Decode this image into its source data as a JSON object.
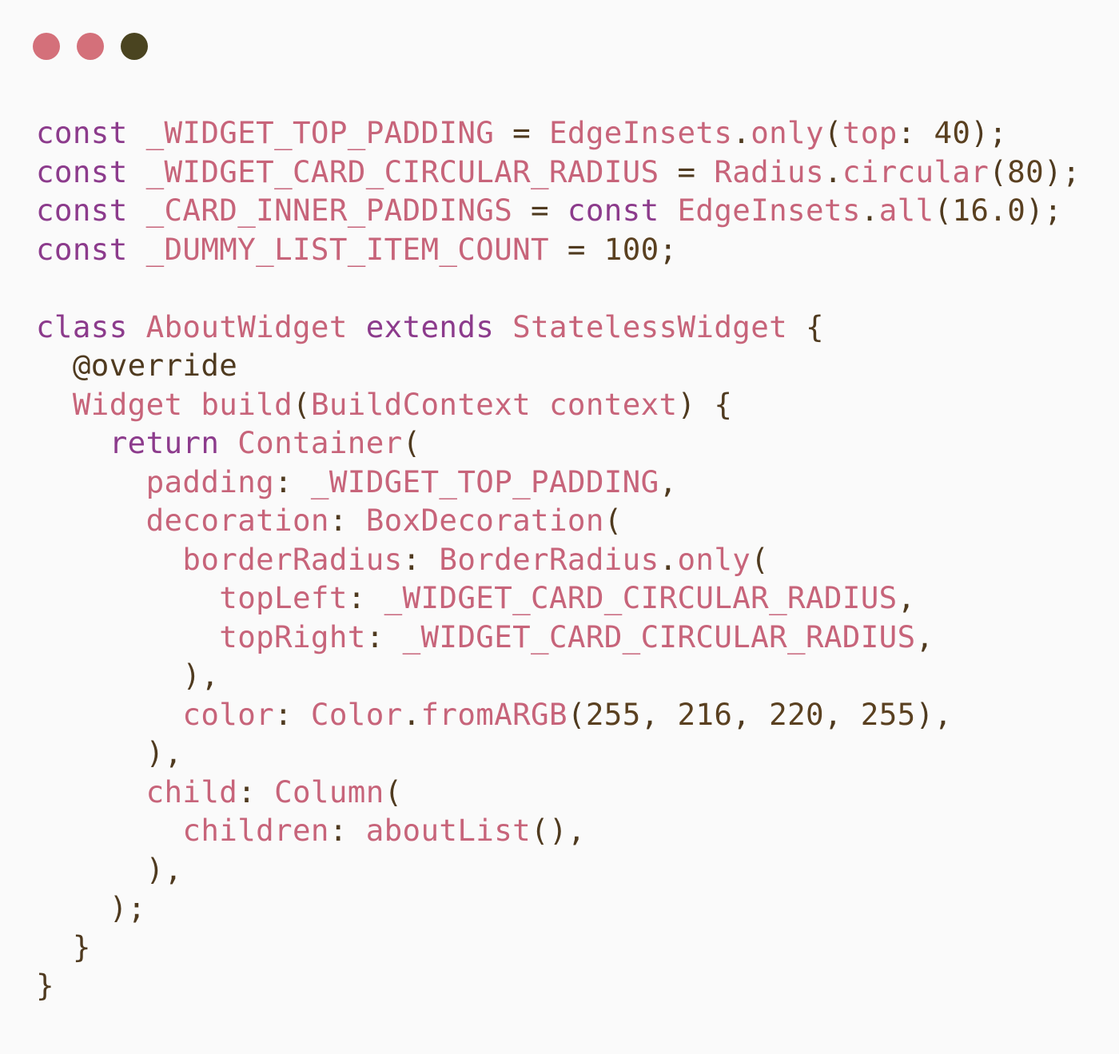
{
  "window": {
    "controls": [
      {
        "name": "close",
        "color": "#d4707a"
      },
      {
        "name": "minimize",
        "color": "#d4707a"
      },
      {
        "name": "maximize",
        "color": "#4a4420"
      }
    ]
  },
  "colors": {
    "keyword": "#8c3b8c",
    "identifier": "#c7647a",
    "plain": "#4f3a1f",
    "number": "#5a4020",
    "background": "#fafafa"
  },
  "code_lines": [
    [
      [
        "keyword",
        "const"
      ],
      [
        "plain",
        " "
      ],
      [
        "ident",
        "_WIDGET_TOP_PADDING"
      ],
      [
        "plain",
        " = "
      ],
      [
        "ident",
        "EdgeInsets"
      ],
      [
        "plain",
        "."
      ],
      [
        "ident",
        "only"
      ],
      [
        "plain",
        "("
      ],
      [
        "ident",
        "top"
      ],
      [
        "plain",
        ": "
      ],
      [
        "number",
        "40"
      ],
      [
        "plain",
        ");"
      ]
    ],
    [
      [
        "keyword",
        "const"
      ],
      [
        "plain",
        " "
      ],
      [
        "ident",
        "_WIDGET_CARD_CIRCULAR_RADIUS"
      ],
      [
        "plain",
        " = "
      ],
      [
        "ident",
        "Radius"
      ],
      [
        "plain",
        "."
      ],
      [
        "ident",
        "circular"
      ],
      [
        "plain",
        "("
      ],
      [
        "number",
        "80"
      ],
      [
        "plain",
        ");"
      ]
    ],
    [
      [
        "keyword",
        "const"
      ],
      [
        "plain",
        " "
      ],
      [
        "ident",
        "_CARD_INNER_PADDINGS"
      ],
      [
        "plain",
        " = "
      ],
      [
        "keyword",
        "const"
      ],
      [
        "plain",
        " "
      ],
      [
        "ident",
        "EdgeInsets"
      ],
      [
        "plain",
        "."
      ],
      [
        "ident",
        "all"
      ],
      [
        "plain",
        "("
      ],
      [
        "number",
        "16.0"
      ],
      [
        "plain",
        ");"
      ]
    ],
    [
      [
        "keyword",
        "const"
      ],
      [
        "plain",
        " "
      ],
      [
        "ident",
        "_DUMMY_LIST_ITEM_COUNT"
      ],
      [
        "plain",
        " = "
      ],
      [
        "number",
        "100"
      ],
      [
        "plain",
        ";"
      ]
    ],
    [],
    [
      [
        "keyword",
        "class"
      ],
      [
        "plain",
        " "
      ],
      [
        "ident",
        "AboutWidget"
      ],
      [
        "plain",
        " "
      ],
      [
        "keyword",
        "extends"
      ],
      [
        "plain",
        " "
      ],
      [
        "ident",
        "StatelessWidget"
      ],
      [
        "plain",
        " {"
      ]
    ],
    [
      [
        "plain",
        "  @override"
      ]
    ],
    [
      [
        "plain",
        "  "
      ],
      [
        "ident",
        "Widget"
      ],
      [
        "plain",
        " "
      ],
      [
        "ident",
        "build"
      ],
      [
        "plain",
        "("
      ],
      [
        "ident",
        "BuildContext"
      ],
      [
        "plain",
        " "
      ],
      [
        "ident",
        "context"
      ],
      [
        "plain",
        ") {"
      ]
    ],
    [
      [
        "plain",
        "    "
      ],
      [
        "keyword",
        "return"
      ],
      [
        "plain",
        " "
      ],
      [
        "ident",
        "Container"
      ],
      [
        "plain",
        "("
      ]
    ],
    [
      [
        "plain",
        "      "
      ],
      [
        "ident",
        "padding"
      ],
      [
        "plain",
        ": "
      ],
      [
        "ident",
        "_WIDGET_TOP_PADDING"
      ],
      [
        "plain",
        ","
      ]
    ],
    [
      [
        "plain",
        "      "
      ],
      [
        "ident",
        "decoration"
      ],
      [
        "plain",
        ": "
      ],
      [
        "ident",
        "BoxDecoration"
      ],
      [
        "plain",
        "("
      ]
    ],
    [
      [
        "plain",
        "        "
      ],
      [
        "ident",
        "borderRadius"
      ],
      [
        "plain",
        ": "
      ],
      [
        "ident",
        "BorderRadius"
      ],
      [
        "plain",
        "."
      ],
      [
        "ident",
        "only"
      ],
      [
        "plain",
        "("
      ]
    ],
    [
      [
        "plain",
        "          "
      ],
      [
        "ident",
        "topLeft"
      ],
      [
        "plain",
        ": "
      ],
      [
        "ident",
        "_WIDGET_CARD_CIRCULAR_RADIUS"
      ],
      [
        "plain",
        ","
      ]
    ],
    [
      [
        "plain",
        "          "
      ],
      [
        "ident",
        "topRight"
      ],
      [
        "plain",
        ": "
      ],
      [
        "ident",
        "_WIDGET_CARD_CIRCULAR_RADIUS"
      ],
      [
        "plain",
        ","
      ]
    ],
    [
      [
        "plain",
        "        ),"
      ]
    ],
    [
      [
        "plain",
        "        "
      ],
      [
        "ident",
        "color"
      ],
      [
        "plain",
        ": "
      ],
      [
        "ident",
        "Color"
      ],
      [
        "plain",
        "."
      ],
      [
        "ident",
        "fromARGB"
      ],
      [
        "plain",
        "("
      ],
      [
        "number",
        "255"
      ],
      [
        "plain",
        ", "
      ],
      [
        "number",
        "216"
      ],
      [
        "plain",
        ", "
      ],
      [
        "number",
        "220"
      ],
      [
        "plain",
        ", "
      ],
      [
        "number",
        "255"
      ],
      [
        "plain",
        "),"
      ]
    ],
    [
      [
        "plain",
        "      ),"
      ]
    ],
    [
      [
        "plain",
        "      "
      ],
      [
        "ident",
        "child"
      ],
      [
        "plain",
        ": "
      ],
      [
        "ident",
        "Column"
      ],
      [
        "plain",
        "("
      ]
    ],
    [
      [
        "plain",
        "        "
      ],
      [
        "ident",
        "children"
      ],
      [
        "plain",
        ": "
      ],
      [
        "ident",
        "aboutList"
      ],
      [
        "plain",
        "(),"
      ]
    ],
    [
      [
        "plain",
        "      ),"
      ]
    ],
    [
      [
        "plain",
        "    );"
      ]
    ],
    [
      [
        "plain",
        "  }"
      ]
    ],
    [
      [
        "plain",
        "}"
      ]
    ]
  ]
}
